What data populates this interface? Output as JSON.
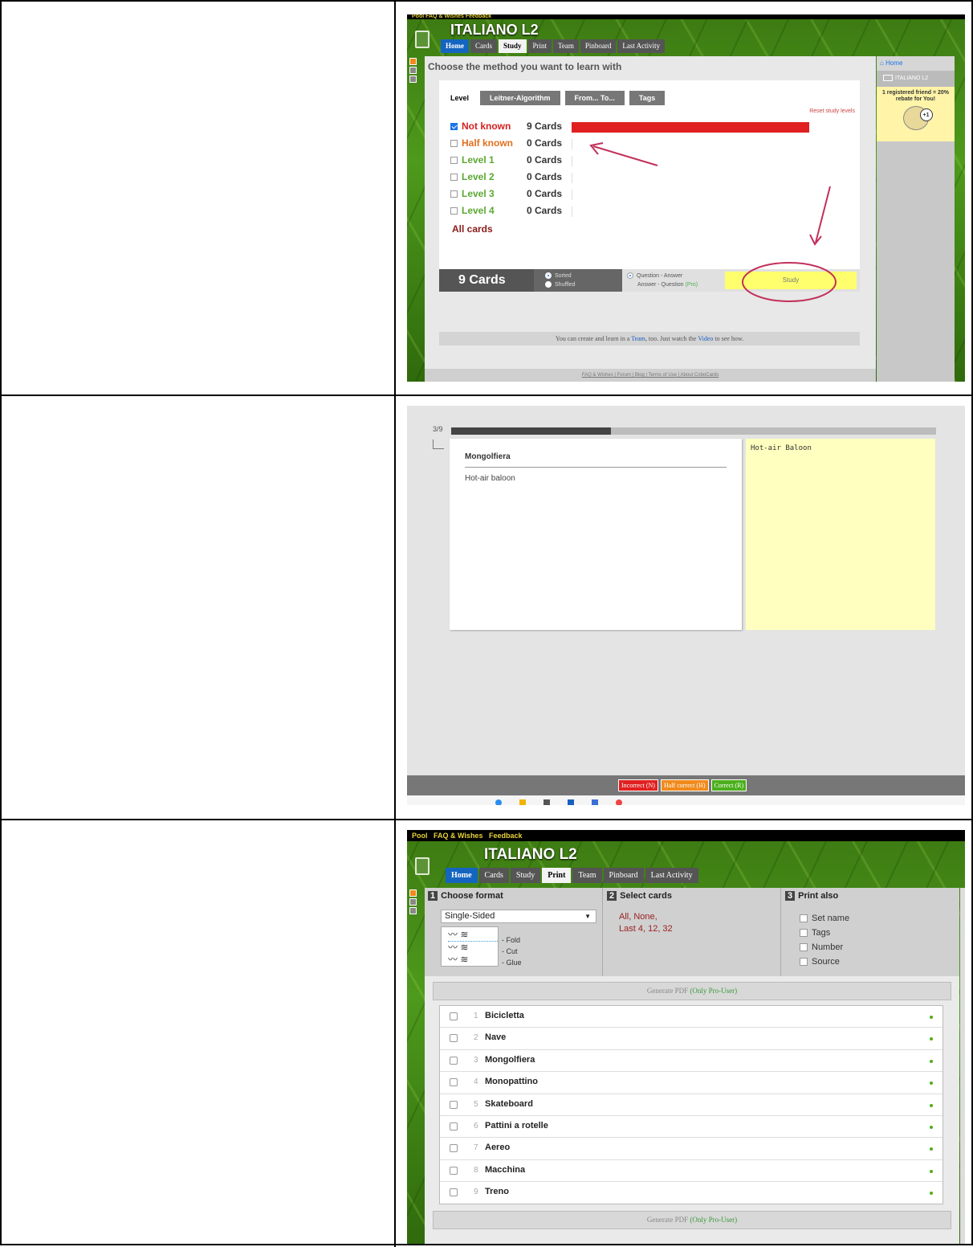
{
  "panel1": {
    "topbar_links": "Pool   FAQ & Wishes   Feedback",
    "app_title": "ITALIANO L2",
    "tabs": [
      "Home",
      "Cards",
      "Study",
      "Print",
      "Team",
      "Pinboard",
      "Last Activity"
    ],
    "heading": "Choose the method you want to learn with",
    "method_tabs": [
      "Level",
      "Leitner-Algorithm",
      "From... To...",
      "Tags"
    ],
    "reset_link": "Reset study levels",
    "levels": [
      {
        "label": "Not known",
        "count": "9 Cards",
        "checked": true,
        "color": "#d42020",
        "fill": 1.0
      },
      {
        "label": "Half known",
        "count": "0 Cards",
        "checked": false,
        "color": "#e07020",
        "fill": 0
      },
      {
        "label": "Level 1",
        "count": "0 Cards",
        "checked": false,
        "color": "#5aa832",
        "fill": 0
      },
      {
        "label": "Level 2",
        "count": "0 Cards",
        "checked": false,
        "color": "#5aa832",
        "fill": 0
      },
      {
        "label": "Level 3",
        "count": "0 Cards",
        "checked": false,
        "color": "#5aa832",
        "fill": 0
      },
      {
        "label": "Level 4",
        "count": "0 Cards",
        "checked": false,
        "color": "#5aa832",
        "fill": 0
      }
    ],
    "all_cards": "All cards",
    "cards_total": "9 Cards",
    "order_options": [
      "Sorted",
      "Shuffled"
    ],
    "direction_options": [
      "Question - Answer",
      "Answer - Question"
    ],
    "pro_label": "(Pro)",
    "study_button": "Study",
    "info_pre": "You can create and learn in a ",
    "info_team": "Team",
    "info_mid": ", too. Just watch the ",
    "info_video": "Video",
    "info_post": " to see how.",
    "footer_links": "FAQ & Wishes | Forum | Blog | Terms of Use | About CoboCards",
    "sidebar_home": "Home",
    "sidebar_deck": "ITALIANO L2",
    "promo_text": "1 registered friend = 20% rebate for You!",
    "promo_badge": "+1"
  },
  "panel2": {
    "progress_label": "3/9",
    "progress": 0.33,
    "question_title": "Mongolfiera",
    "question_text": "Hot-air baloon",
    "answer_text": "Hot-air Baloon",
    "buttons": [
      "Incorrect (N)",
      "Half correct (H)",
      "Correct (R)"
    ],
    "button_colors": [
      "#e02020",
      "#f08a1c",
      "#4caf1c"
    ]
  },
  "panel3": {
    "topbar_links": [
      "Pool",
      "FAQ & Wishes",
      "Feedback"
    ],
    "app_title": "ITALIANO L2",
    "tabs": [
      "Home",
      "Cards",
      "Study",
      "Print",
      "Team",
      "Pinboard",
      "Last Activity"
    ],
    "section1_num": "1",
    "section1_title": "Choose format",
    "format_value": "Single-Sided",
    "format_notes": [
      "- Fold",
      "- Cut",
      "- Glue"
    ],
    "section2_num": "2",
    "section2_title": "Select cards",
    "select_line1": "All, None,",
    "select_line2": "Last 4, 12, 32",
    "section3_num": "3",
    "section3_title": "Print also",
    "print_also": [
      "Set name",
      "Tags",
      "Number",
      "Source"
    ],
    "generate_pre": "Generate PDF ",
    "generate_pro": "(Only Pro-User)",
    "cards": [
      {
        "num": "1",
        "name": "Bicicletta"
      },
      {
        "num": "2",
        "name": "Nave"
      },
      {
        "num": "3",
        "name": "Mongolfiera"
      },
      {
        "num": "4",
        "name": "Monopattino"
      },
      {
        "num": "5",
        "name": "Skateboard"
      },
      {
        "num": "6",
        "name": "Pattini a rotelle"
      },
      {
        "num": "7",
        "name": "Aereo"
      },
      {
        "num": "8",
        "name": "Macchina"
      },
      {
        "num": "9",
        "name": "Treno"
      }
    ]
  }
}
